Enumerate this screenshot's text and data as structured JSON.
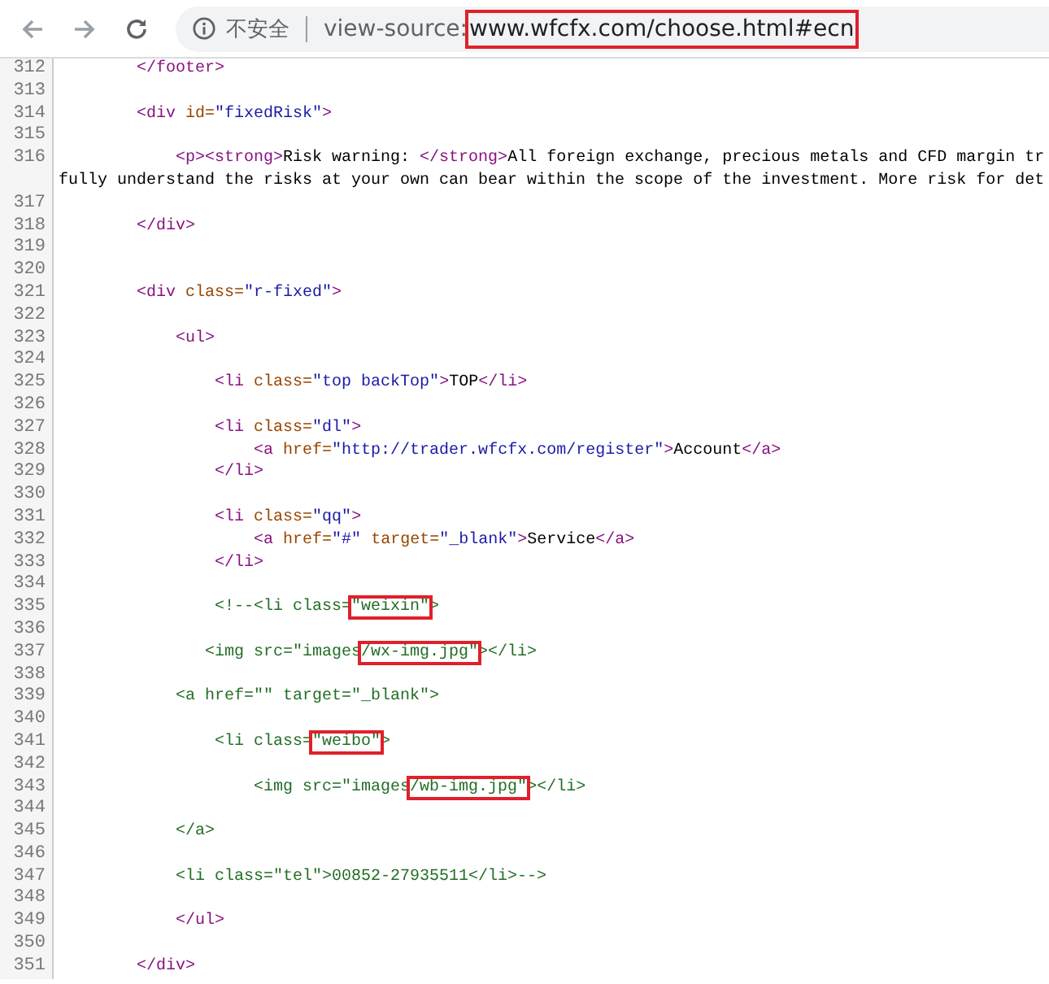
{
  "toolbar": {
    "security_label": "不安全",
    "scheme": "view-source:",
    "url": "www.wfcfx.com/choose.html#ecn",
    "url_highlighted": true
  },
  "lines": [
    {
      "number": "312",
      "tokens": [
        {
          "kind": "tag",
          "text": "        </footer>"
        }
      ]
    },
    {
      "number": "313"
    },
    {
      "number": "314",
      "tokens": [
        {
          "kind": "tag",
          "text": "        <div"
        },
        {
          "kind": "attr",
          "text": " id="
        },
        {
          "kind": "value",
          "text": "\"fixedRisk\""
        },
        {
          "kind": "tag",
          "text": ">"
        }
      ]
    },
    {
      "number": "315"
    },
    {
      "number": "316",
      "tokens": [
        {
          "kind": "tag",
          "text": "            <p><strong>"
        },
        {
          "kind": "text",
          "text": "Risk warning: "
        },
        {
          "kind": "tag",
          "text": "</strong>"
        },
        {
          "kind": "text",
          "text": "All foreign exchange, precious metals and CFD margin tr"
        }
      ]
    },
    {
      "tokens": [
        {
          "kind": "text",
          "text": "fully understand the risks at your own can bear within the scope of the investment. More risk for det"
        }
      ]
    },
    {
      "number": "317"
    },
    {
      "number": "318",
      "tokens": [
        {
          "kind": "tag",
          "text": "        </div>"
        }
      ]
    },
    {
      "number": "319"
    },
    {
      "number": "320"
    },
    {
      "number": "321",
      "tokens": [
        {
          "kind": "tag",
          "text": "        <div"
        },
        {
          "kind": "attr",
          "text": " class="
        },
        {
          "kind": "value",
          "text": "\"r-fixed\""
        },
        {
          "kind": "tag",
          "text": ">"
        }
      ]
    },
    {
      "number": "322"
    },
    {
      "number": "323",
      "tokens": [
        {
          "kind": "tag",
          "text": "            <ul>"
        }
      ]
    },
    {
      "number": "324"
    },
    {
      "number": "325",
      "tokens": [
        {
          "kind": "tag",
          "text": "                <li"
        },
        {
          "kind": "attr",
          "text": " class="
        },
        {
          "kind": "value",
          "text": "\"top backTop\""
        },
        {
          "kind": "tag",
          "text": ">"
        },
        {
          "kind": "text",
          "text": "TOP"
        },
        {
          "kind": "tag",
          "text": "</li>"
        }
      ]
    },
    {
      "number": "326"
    },
    {
      "number": "327",
      "tokens": [
        {
          "kind": "tag",
          "text": "                <li"
        },
        {
          "kind": "attr",
          "text": " class="
        },
        {
          "kind": "value",
          "text": "\"dl\""
        },
        {
          "kind": "tag",
          "text": ">"
        }
      ]
    },
    {
      "number": "328",
      "tokens": [
        {
          "kind": "tag",
          "text": "                    <a"
        },
        {
          "kind": "attr",
          "text": " href="
        },
        {
          "kind": "value",
          "text": "\"http://trader.wfcfx.com/register\""
        },
        {
          "kind": "tag",
          "text": ">"
        },
        {
          "kind": "text",
          "text": "Account"
        },
        {
          "kind": "tag",
          "text": "</a>"
        }
      ]
    },
    {
      "number": "329",
      "tokens": [
        {
          "kind": "tag",
          "text": "                </li>"
        }
      ]
    },
    {
      "number": "330"
    },
    {
      "number": "331",
      "tokens": [
        {
          "kind": "tag",
          "text": "                <li"
        },
        {
          "kind": "attr",
          "text": " class="
        },
        {
          "kind": "value",
          "text": "\"qq\""
        },
        {
          "kind": "tag",
          "text": ">"
        }
      ]
    },
    {
      "number": "332",
      "tokens": [
        {
          "kind": "tag",
          "text": "                    <a"
        },
        {
          "kind": "attr",
          "text": " href="
        },
        {
          "kind": "value",
          "text": "\"#\""
        },
        {
          "kind": "attr",
          "text": " target="
        },
        {
          "kind": "value",
          "text": "\"_blank\""
        },
        {
          "kind": "tag",
          "text": ">"
        },
        {
          "kind": "text",
          "text": "Service"
        },
        {
          "kind": "tag",
          "text": "</a>"
        }
      ]
    },
    {
      "number": "333",
      "tokens": [
        {
          "kind": "tag",
          "text": "                </li>"
        }
      ]
    },
    {
      "number": "334"
    },
    {
      "number": "335",
      "tokens": [
        {
          "kind": "comment",
          "text": "                <!--<li class="
        },
        {
          "kind": "comment",
          "text": "\"weixin\"",
          "highlighted": true
        },
        {
          "kind": "comment",
          "text": ">"
        }
      ]
    },
    {
      "number": "336"
    },
    {
      "number": "337",
      "tokens": [
        {
          "kind": "comment",
          "text": "               <img src=\"images"
        },
        {
          "kind": "comment",
          "text": "/wx-img.jpg\"",
          "highlighted": true
        },
        {
          "kind": "comment",
          "text": "></li>"
        }
      ]
    },
    {
      "number": "338"
    },
    {
      "number": "339",
      "tokens": [
        {
          "kind": "comment",
          "text": "            <a href=\"\" target=\"_blank\">"
        }
      ]
    },
    {
      "number": "340"
    },
    {
      "number": "341",
      "tokens": [
        {
          "kind": "comment",
          "text": "                <li class="
        },
        {
          "kind": "comment",
          "text": "\"weibo\"",
          "highlighted": true
        },
        {
          "kind": "comment",
          "text": ">"
        }
      ]
    },
    {
      "number": "342"
    },
    {
      "number": "343",
      "tokens": [
        {
          "kind": "comment",
          "text": "                    <img src=\"images"
        },
        {
          "kind": "comment",
          "text": "/wb-img.jpg\"",
          "highlighted": true
        },
        {
          "kind": "comment",
          "text": "></li>"
        }
      ]
    },
    {
      "number": "344"
    },
    {
      "number": "345",
      "tokens": [
        {
          "kind": "comment",
          "text": "            </a>"
        }
      ]
    },
    {
      "number": "346"
    },
    {
      "number": "347",
      "tokens": [
        {
          "kind": "comment",
          "text": "            <li class=\"tel\">00852-27935511</li>-->"
        }
      ]
    },
    {
      "number": "348"
    },
    {
      "number": "349",
      "tokens": [
        {
          "kind": "tag",
          "text": "            </ul>"
        }
      ]
    },
    {
      "number": "350"
    },
    {
      "number": "351",
      "tokens": [
        {
          "kind": "tag",
          "text": "        </div>"
        }
      ]
    }
  ]
}
